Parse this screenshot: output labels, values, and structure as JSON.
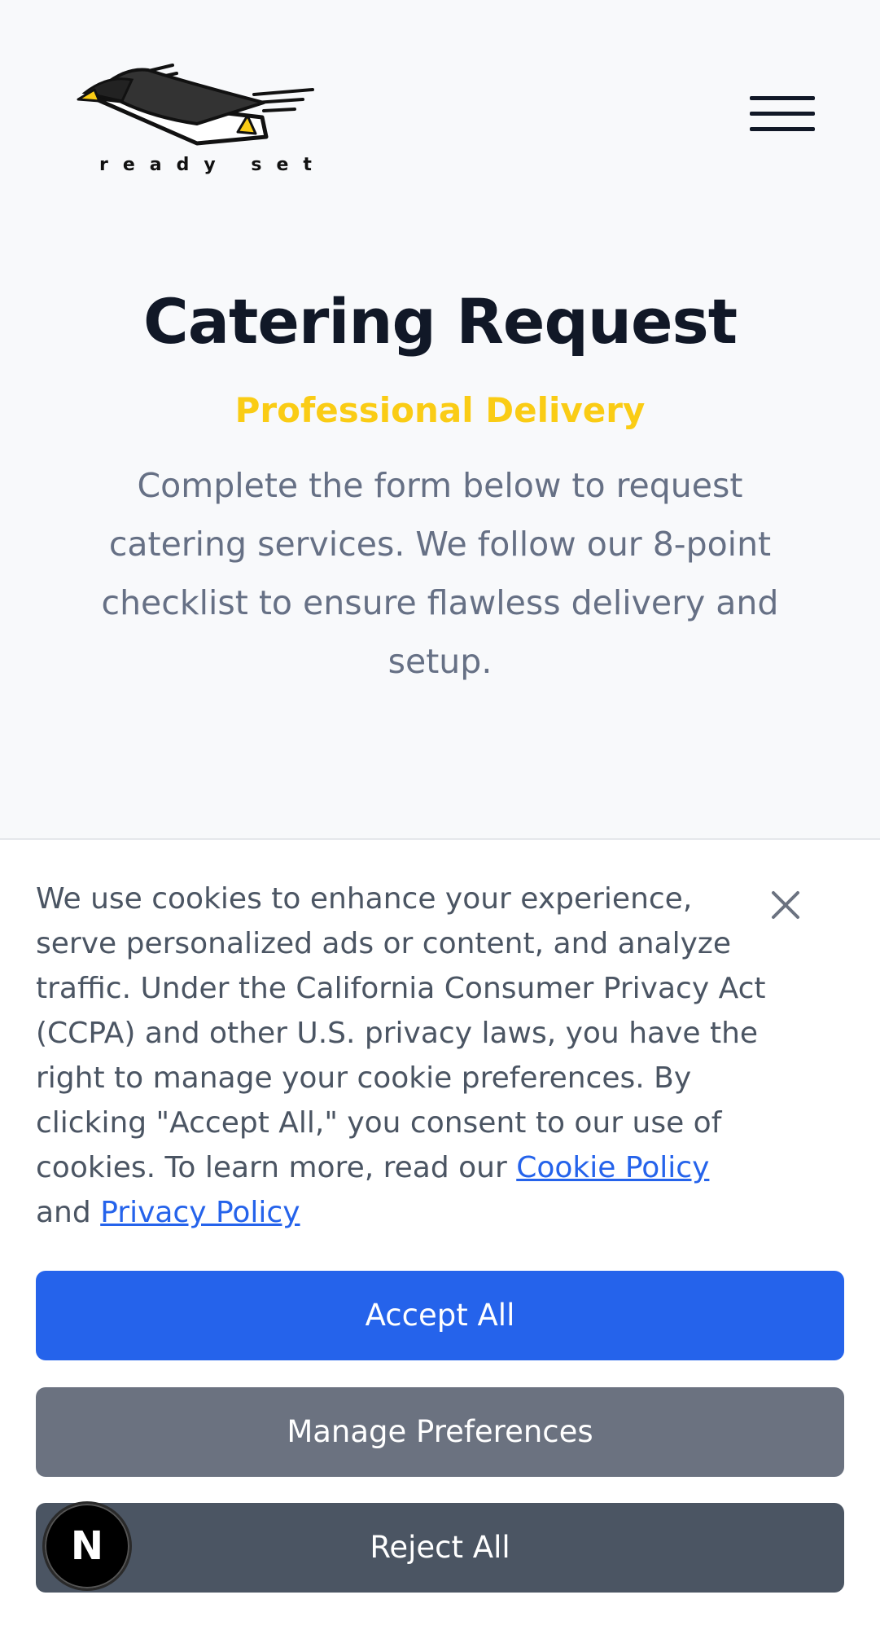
{
  "header": {
    "logo_text": "ready  set",
    "menu_icon": "hamburger-menu-icon"
  },
  "hero": {
    "title": "Catering Request",
    "subtitle": "Professional Delivery",
    "intro": "Complete the form below to request catering services. We follow our 8-point checklist to ensure flawless delivery and setup."
  },
  "cookie_banner": {
    "text": "We use cookies to enhance your experience, serve personalized ads or content, and analyze traffic. Under the California Consumer Privacy Act (CCPA) and other U.S. privacy laws, you have the right to manage your cookie preferences. By clicking \"Accept All,\" you consent to our use of cookies. To learn more, read our",
    "cookie_policy_link": "Cookie Policy",
    "and_text": "and",
    "privacy_policy_link": "Privacy Policy",
    "close_icon": "close-icon",
    "accept_label": "Accept All",
    "manage_label": "Manage Preferences",
    "reject_label": "Reject All"
  },
  "floating_badge": {
    "label": "N"
  },
  "colors": {
    "background": "#f8f9fb",
    "title": "#111827",
    "accent_yellow": "#facc15",
    "body_text": "#667085",
    "link": "#2563eb",
    "accept": "#2563eb",
    "manage": "#6b7280",
    "reject": "#4b5563"
  }
}
